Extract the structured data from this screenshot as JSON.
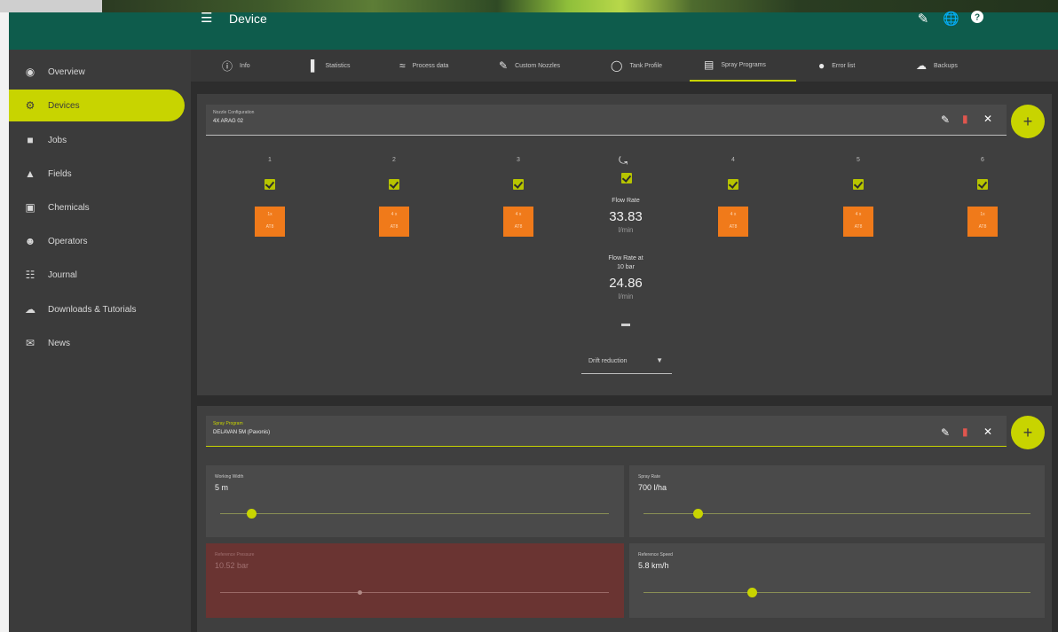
{
  "header": {
    "title": "Device"
  },
  "sidebar": {
    "items": [
      {
        "label": "Overview",
        "icon": "eye-icon"
      },
      {
        "label": "Devices",
        "icon": "tractor-icon"
      },
      {
        "label": "Jobs",
        "icon": "briefcase-icon"
      },
      {
        "label": "Fields",
        "icon": "field-icon"
      },
      {
        "label": "Chemicals",
        "icon": "canister-icon"
      },
      {
        "label": "Operators",
        "icon": "person-icon"
      },
      {
        "label": "Journal",
        "icon": "journal-icon"
      },
      {
        "label": "Downloads & Tutorials",
        "icon": "cloud-icon"
      },
      {
        "label": "News",
        "icon": "mail-icon"
      }
    ]
  },
  "tabs": [
    {
      "label": "Info",
      "icon": "info-icon"
    },
    {
      "label": "Statistics",
      "icon": "bar-chart-icon"
    },
    {
      "label": "Process data",
      "icon": "line-chart-icon"
    },
    {
      "label": "Custom Nozzles",
      "icon": "nozzle-icon"
    },
    {
      "label": "Tank Profile",
      "icon": "tank-icon"
    },
    {
      "label": "Spray Programs",
      "icon": "document-icon"
    },
    {
      "label": "Error list",
      "icon": "error-icon"
    },
    {
      "label": "Backups",
      "icon": "cloud-upload-icon"
    }
  ],
  "nozzle_config": {
    "label": "Nozzle Configuration",
    "value": "4X ARAG 02",
    "sections": [
      {
        "num": "1",
        "nozzle_top": "1x",
        "nozzle_bottom": "AT8"
      },
      {
        "num": "2",
        "nozzle_top": "4 x",
        "nozzle_bottom": "AT8"
      },
      {
        "num": "3",
        "nozzle_top": "4 x",
        "nozzle_bottom": "AT8"
      },
      {
        "num": "4",
        "nozzle_top": "4 x",
        "nozzle_bottom": "AT8"
      },
      {
        "num": "5",
        "nozzle_top": "4 x",
        "nozzle_bottom": "AT8"
      },
      {
        "num": "6",
        "nozzle_top": "1x",
        "nozzle_bottom": "AT8"
      }
    ],
    "flow_rate_label": "Flow Rate",
    "flow_rate_value": "33.83",
    "flow_rate_unit": "l/min",
    "flow_rate_10_label": "Flow Rate at 10 bar",
    "flow_rate_10_value": "24.86",
    "flow_rate_10_unit": "l/min",
    "drift_select": "Drift reduction"
  },
  "spray_program": {
    "label": "Spray Program",
    "value": "DELAVAN 5M (Pavonis)",
    "working_width_label": "Working Width",
    "working_width_value": "5 m",
    "working_width_level": 0.08,
    "spray_rate_label": "Spray Rate",
    "spray_rate_value": "700 l/ha",
    "spray_rate_level": 0.14,
    "ref_pressure_label": "Reference Pressure",
    "ref_pressure_value": "10.52 bar",
    "ref_pressure_level": 0.36,
    "ref_speed_label": "Reference Speed",
    "ref_speed_value": "5.8 km/h",
    "ref_speed_level": 0.28
  },
  "colors": {
    "header": "#0e5c4c",
    "accent": "#c8d400",
    "nozzle": "#f07a1a",
    "warning_panel": "#6a3432"
  }
}
